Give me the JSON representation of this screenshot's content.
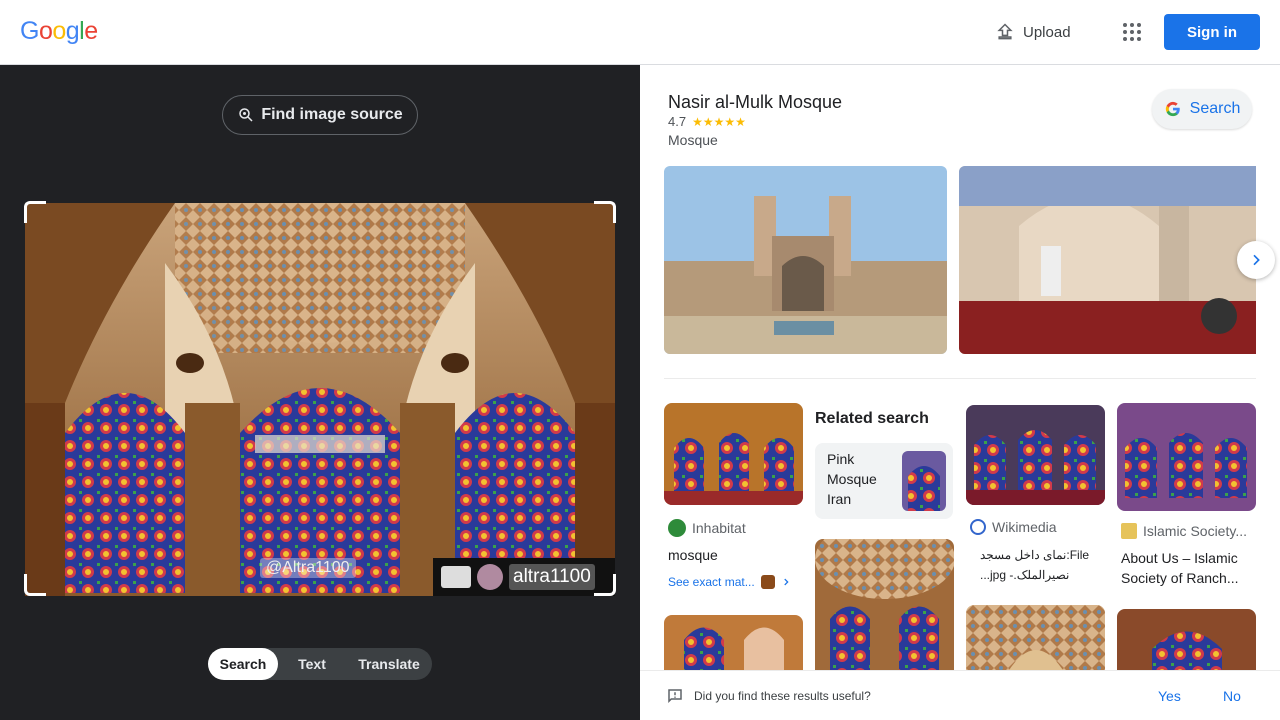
{
  "header": {
    "logo": [
      "G",
      "o",
      "o",
      "g",
      "l",
      "e"
    ],
    "logo_colors": [
      "#4285f4",
      "#ea4335",
      "#fbbc05",
      "#4285f4",
      "#34a853",
      "#ea4335"
    ],
    "upload_label": "Upload",
    "signin_label": "Sign in"
  },
  "lens": {
    "find_source_label": "Find image source",
    "watermark_handle": "@Altra1100",
    "watermark_user": "altra1100",
    "tabs": [
      "Search",
      "Text",
      "Translate"
    ],
    "active_tab": "Search"
  },
  "knowledge_panel": {
    "title": "Nasir al-Mulk Mosque",
    "rating": "4.7",
    "rating_stars": 4.7,
    "type": "Mosque",
    "search_label": "Search"
  },
  "results": {
    "col1": {
      "source": "Inhabitat",
      "title": "mosque",
      "see_exact": "See exact mat..."
    },
    "related": {
      "heading": "Related search",
      "query": "Pink Mosque Iran"
    },
    "col3": {
      "source": "Wikimedia",
      "title_line1": "File:نمای داخل مسجد",
      "title_line2": "نصیرالملک.- jpg..."
    },
    "col4": {
      "source": "Islamic Society...",
      "title_line1": "About Us – Islamic",
      "title_line2": "Society of Ranch..."
    }
  },
  "feedback": {
    "question": "Did you find these results useful?",
    "yes": "Yes",
    "no": "No"
  },
  "colors": {
    "accent": "#1a73e8",
    "dark_panel": "#202124",
    "star": "#fbbc04"
  }
}
